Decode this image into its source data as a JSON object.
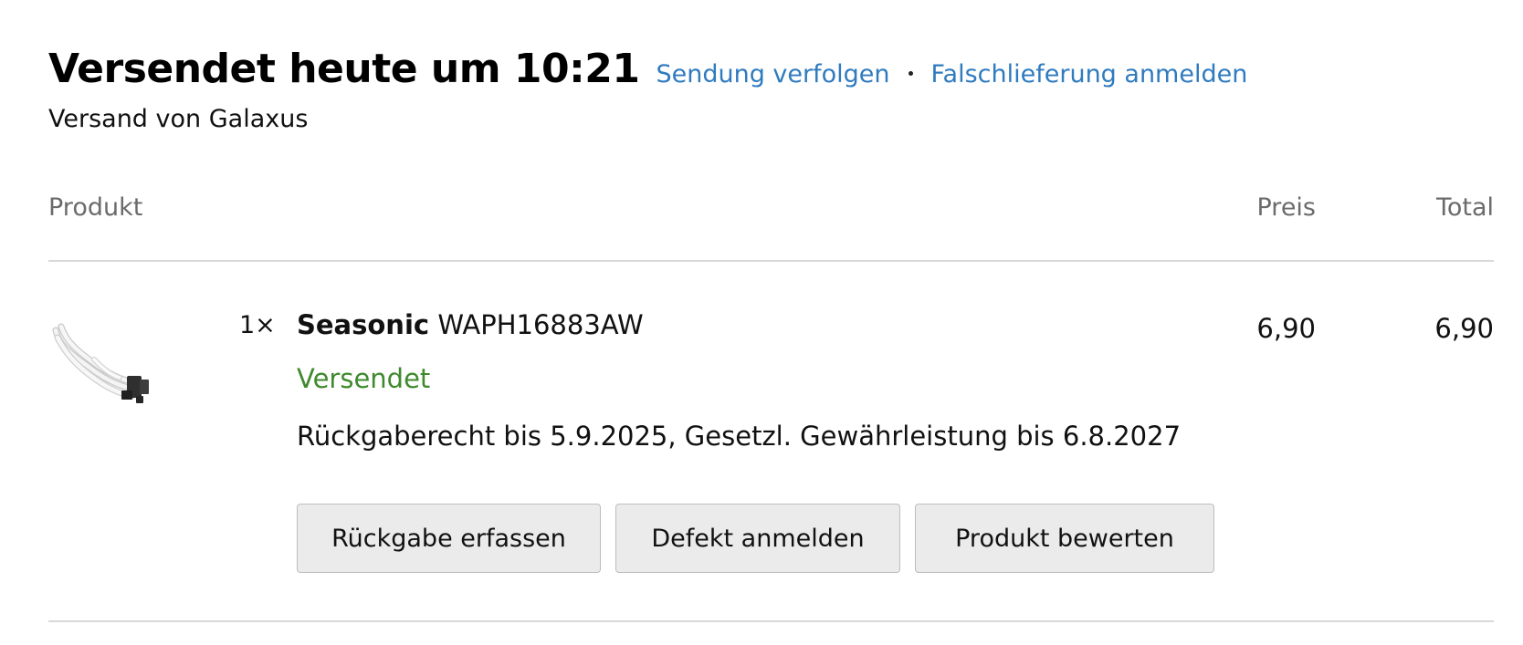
{
  "shipment": {
    "title": "Versendet heute um 10:21",
    "track_link": "Sendung verfolgen",
    "wrong_delivery_link": "Falschlieferung anmelden",
    "shipper": "Versand von Galaxus"
  },
  "table": {
    "headers": {
      "product": "Produkt",
      "price": "Preis",
      "total": "Total"
    }
  },
  "item": {
    "quantity": "1×",
    "brand": "Seasonic",
    "model": "WAPH16883AW",
    "status": "Versendet",
    "status_color": "#3f8a2e",
    "policy": "Rückgaberecht bis 5.9.2025, Gesetzl. Gewährleistung bis 6.8.2027",
    "price": "6,90",
    "total": "6,90",
    "image_icon": "cable-product-image"
  },
  "actions": {
    "return": "Rückgabe erfassen",
    "defect": "Defekt anmelden",
    "review": "Produkt bewerten"
  },
  "colors": {
    "link": "#2f7bbf",
    "divider": "#d9d9d9",
    "button_bg": "#ebebeb"
  }
}
